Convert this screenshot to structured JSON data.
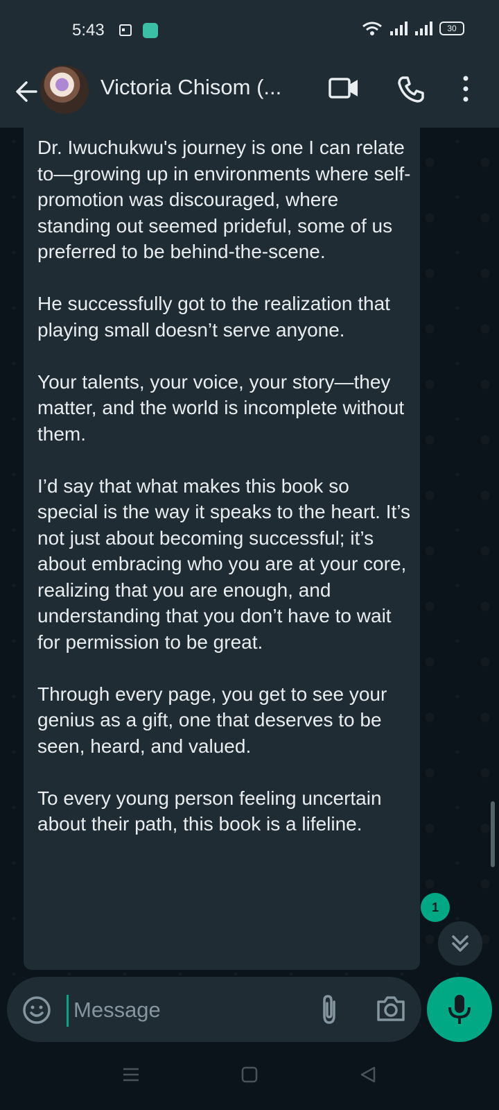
{
  "status_bar": {
    "time": "5:43",
    "battery": "30"
  },
  "header": {
    "contact_name": "Victoria Chisom (..."
  },
  "message": {
    "paragraphs": [
      "Dr. Iwuchukwu's journey is one I can relate to—growing up in environments where self-promotion was discouraged, where standing out seemed prideful, some of us preferred to be behind-the-scene.",
      "He successfully got to the realization that playing small doesn’t serve anyone.",
      "Your talents, your voice, your story—they matter, and the world is incomplete without them.",
      "I’d say that what makes this book so special is the way it speaks to the heart. It’s not just about becoming successful; it’s about embracing who you are at your core, realizing that you are enough, and understanding that you don’t have to wait for permission to be great.",
      "Through every page, you get to see your genius as a gift, one that deserves to be seen, heard, and valued.",
      "To every young person feeling uncertain about their path, this book is a lifeline."
    ]
  },
  "unread_count": "1",
  "composer": {
    "placeholder": "Message"
  },
  "colors": {
    "accent": "#00a884",
    "header_bg": "#1f2c34",
    "chat_bg": "#0b141a",
    "text": "#e9edef"
  }
}
